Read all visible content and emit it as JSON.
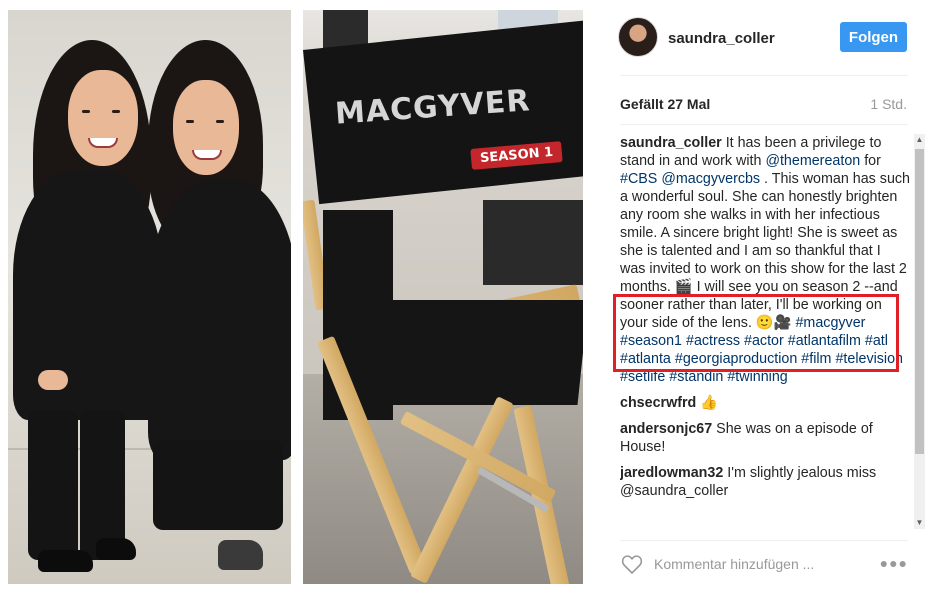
{
  "post": {
    "username": "saundra_coller",
    "follow_label": "Folgen",
    "likes": "Gefällt 27 Mal",
    "time_ago": "1 Std."
  },
  "photo": {
    "chair_logo": "MACGYVER",
    "chair_sub": "SEASON 1"
  },
  "caption": {
    "user": "saundra_coller",
    "parts": [
      {
        "text": " It has been a privilege to stand in and work with ",
        "type": "text"
      },
      {
        "text": "@themereaton",
        "type": "mention"
      },
      {
        "text": " for ",
        "type": "text"
      },
      {
        "text": "#CBS",
        "type": "tag"
      },
      {
        "text": " ",
        "type": "text"
      },
      {
        "text": "@macgyvercbs",
        "type": "mention"
      },
      {
        "text": " . This woman has such a wonderful soul. She can honestly brighten any room she walks in with her infectious smile. A sincere bright light! She is sweet as she is talented and I am so thankful that I was invited to work on this show for the last 2 months. 🎬 I will see you on season 2 --and sooner rather than later, I'll be working on your side of the lens. 🙂🎥 ",
        "type": "text"
      },
      {
        "text": "#macgyver",
        "type": "tag"
      },
      {
        "text": " ",
        "type": "text"
      },
      {
        "text": "#season1",
        "type": "tag"
      },
      {
        "text": " ",
        "type": "text"
      },
      {
        "text": "#actress",
        "type": "tag"
      },
      {
        "text": " ",
        "type": "text"
      },
      {
        "text": "#actor",
        "type": "tag"
      },
      {
        "text": " ",
        "type": "text"
      },
      {
        "text": "#atlantafilm",
        "type": "tag"
      },
      {
        "text": " ",
        "type": "text"
      },
      {
        "text": "#atl",
        "type": "tag"
      },
      {
        "text": " ",
        "type": "text"
      },
      {
        "text": "#atlanta",
        "type": "tag"
      },
      {
        "text": " ",
        "type": "text"
      },
      {
        "text": "#georgiaproduction",
        "type": "tag"
      },
      {
        "text": " ",
        "type": "text"
      },
      {
        "text": "#film",
        "type": "tag"
      },
      {
        "text": " ",
        "type": "text"
      },
      {
        "text": "#television",
        "type": "tag"
      },
      {
        "text": " ",
        "type": "text"
      },
      {
        "text": "#setlife",
        "type": "tag"
      },
      {
        "text": " ",
        "type": "text"
      },
      {
        "text": "#standin",
        "type": "tag"
      },
      {
        "text": " ",
        "type": "text"
      },
      {
        "text": "#twinning",
        "type": "tag"
      }
    ]
  },
  "comments": [
    {
      "user": "chsecrwfrd",
      "text": " 👍"
    },
    {
      "user": "andersonjc67",
      "text": " She was on a episode of House!"
    },
    {
      "user": "jaredlowman32",
      "text": " I'm slightly jealous miss @saundra_coller"
    }
  ],
  "comment_box": {
    "placeholder": "Kommentar hinzufügen ..."
  },
  "icons": {
    "heart": "heart-icon",
    "more": "more-options-icon"
  },
  "colors": {
    "accent": "#3897f0",
    "highlight": "#e01f26",
    "link": "#003569"
  }
}
